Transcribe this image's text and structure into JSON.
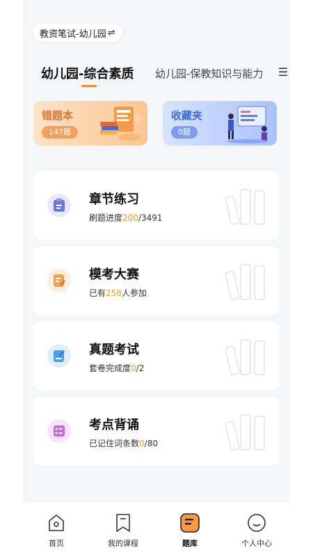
{
  "header": {
    "exam_label": "教资笔试-幼儿园",
    "switch_icon": "⇌"
  },
  "tabs": [
    {
      "label": "幼儿园-综合素质",
      "active": true
    },
    {
      "label": "幼儿园-保教知识与能力",
      "active": false
    }
  ],
  "menu_icon": "☰",
  "cards": {
    "wrong": {
      "title": "错题本",
      "count": "147题"
    },
    "favorite": {
      "title": "收藏夹",
      "count": "0题"
    }
  },
  "list": [
    {
      "title": "章节练习",
      "prefix": "刷题进度",
      "value": "200",
      "suffix": "/3491",
      "icon": "clipboard-icon"
    },
    {
      "title": "模考大赛",
      "prefix": "已有",
      "value": "258",
      "suffix": "人参加",
      "icon": "edit-icon"
    },
    {
      "title": "真题考试",
      "prefix": "套卷完成度",
      "value": "0",
      "suffix": "/2",
      "icon": "pen-paper-icon"
    },
    {
      "title": "考点背诵",
      "prefix": "已记住词条数",
      "value": "0",
      "suffix": "/80",
      "icon": "checklist-icon"
    }
  ],
  "tabbar": [
    {
      "label": "首页",
      "icon": "home-icon"
    },
    {
      "label": "我的课程",
      "icon": "bookmark-icon"
    },
    {
      "label": "题库",
      "icon": "question-bank-icon",
      "active": true
    },
    {
      "label": "个人中心",
      "icon": "smile-icon"
    }
  ],
  "colors": {
    "accent": "#f28a2e",
    "highlight": "#e89e18",
    "blue": "#3d6bd8"
  }
}
